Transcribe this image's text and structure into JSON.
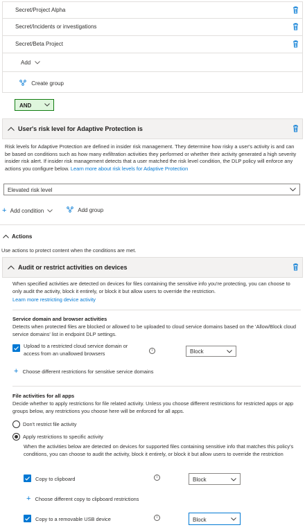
{
  "groups": [
    {
      "label": "Secret/Project Alpha"
    },
    {
      "label": "Secret/Incidents or investigations"
    },
    {
      "label": "Secret/Beta Project"
    }
  ],
  "add_label": "Add",
  "create_group_label": "Create group",
  "operator_value": "AND",
  "risk_section": {
    "title": "User's risk level for Adaptive Protection is",
    "description": "Risk levels for Adaptive Protection are defined in insider risk management. They determine how risky a user's activity is and can be based on conditions such as how many exfiltration activities they performed or whether their activity generated a high severity insider risk alert. If insider risk management detects that a user matched the risk level condition, the DLP policy will enforce any actions you configure below.",
    "learn_more_link": "Learn more about risk levels for Adaptive Protection",
    "selected_level": "Elevated risk level"
  },
  "add_condition_label": "Add condition",
  "add_group_label": "Add group",
  "actions": {
    "title": "Actions",
    "description": "Use actions to protect content when the conditions are met."
  },
  "audit_section": {
    "title": "Audit or restrict activities on devices",
    "description": "When specified activities are detected on devices for files containing the sensitive info you're protecting, you can choose to only audit the activity, block it entirely, or block it but allow users to override the restriction.",
    "learn_more_link": "Learn more restricting device activity",
    "service_domain": {
      "title": "Service domain and browser activities",
      "description": "Detects when protected files are blocked or allowed to be uploaded to cloud service domains based on the 'Allow/Block cloud service domains' list in endpoint DLP settings.",
      "upload_label": "Upload to a restricted cloud service domain or access from an unallowed browsers",
      "upload_action": "Block",
      "choose_label": "Choose different restrictions for sensitive service domains"
    },
    "file_activities": {
      "title": "File activities for all apps",
      "description": "Decide whether to apply restrictions for file related activity. Unless you choose different restrictions for restricted apps or app groups below, any restrictions you choose here will be enforced for all apps.",
      "radio_dont": "Don't restrict file activity",
      "radio_apply": "Apply restrictions to specific activity",
      "apply_description": "When the activities below are detected on devices for supported files containing sensitive info that matches this policy's conditions, you can choose to audit the activity, block it entirely, or block it but allow users to override the restriction",
      "clipboard_label": "Copy to clipboard",
      "clipboard_action": "Block",
      "clipboard_choose_label": "Choose different copy to clipboard restrictions",
      "usb_label": "Copy to a removable USB device",
      "usb_action": "Block"
    }
  },
  "colors": {
    "accent": "#0078d4",
    "operator_bg": "#dff6dd",
    "operator_border": "#107c10",
    "header_bg": "#f3f2f1"
  }
}
